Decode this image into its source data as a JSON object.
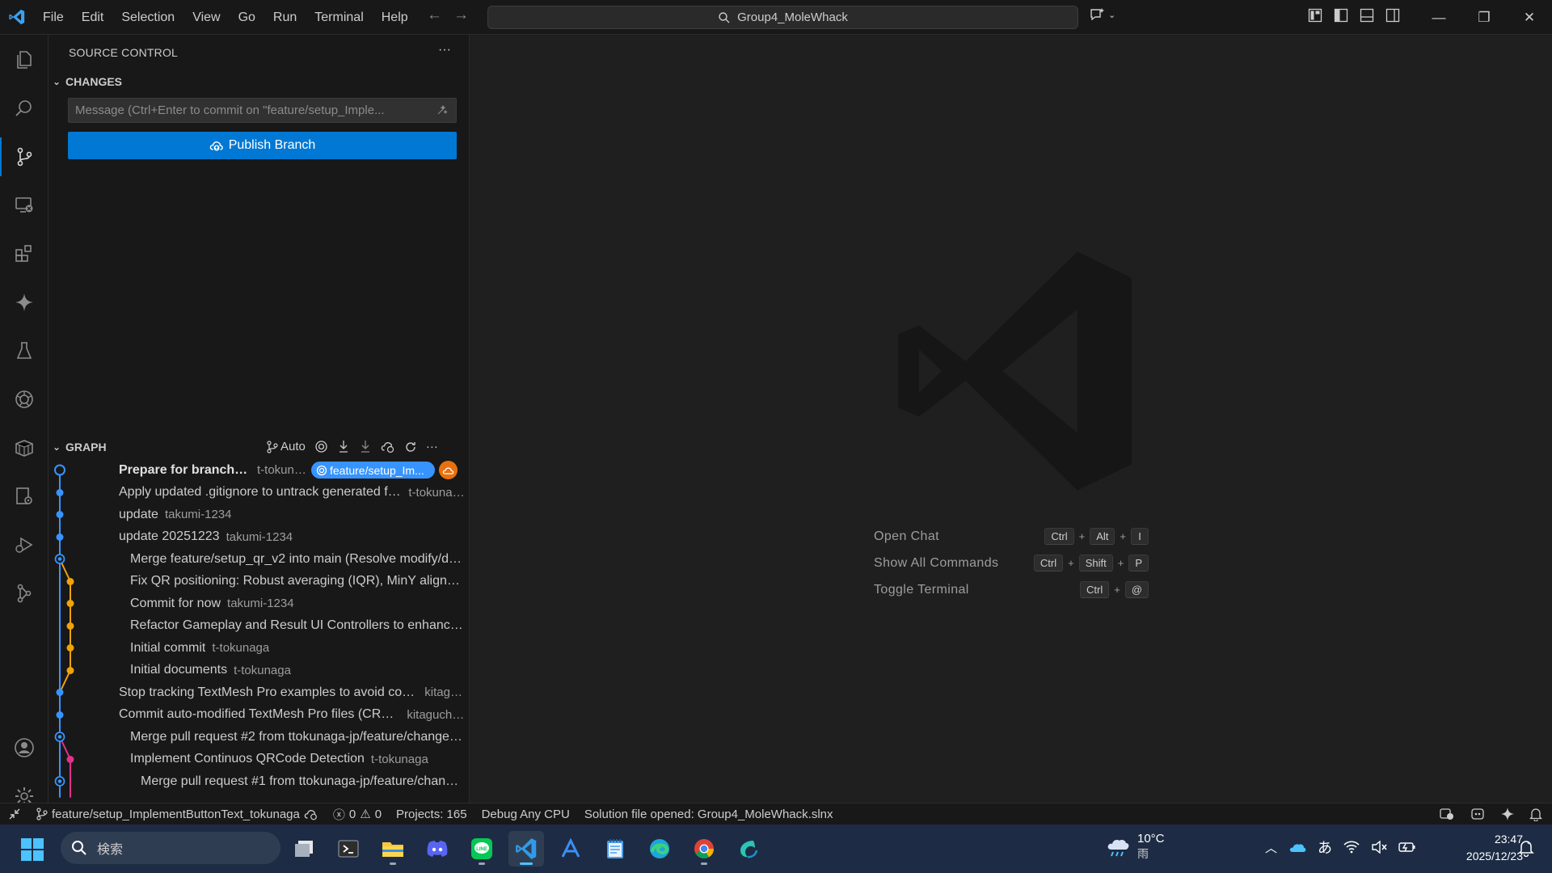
{
  "window": {
    "search_text": "Group4_MoleWhack",
    "menu": [
      "File",
      "Edit",
      "Selection",
      "View",
      "Go",
      "Run",
      "Terminal",
      "Help"
    ]
  },
  "sidebar": {
    "title": "SOURCE CONTROL",
    "changes_label": "CHANGES",
    "commit_placeholder": "Message (Ctrl+Enter to commit on \"feature/setup_Imple...",
    "publish_label": "Publish Branch",
    "graph_label": "GRAPH",
    "graph_auto_label": "Auto",
    "branch_badge": "feature/setup_Im...",
    "commits": [
      {
        "message": "Prepare for branch split",
        "author": "t-tokunaga",
        "color": "#3794ff",
        "lane": 0,
        "hollow": true
      },
      {
        "message": "Apply updated .gitignore to untrack generated files",
        "author": "t-tokunaga",
        "color": "#3794ff",
        "lane": 0
      },
      {
        "message": "update",
        "author": "takumi-1234",
        "color": "#3794ff",
        "lane": 0
      },
      {
        "message": "update 20251223",
        "author": "takumi-1234",
        "color": "#3794ff",
        "lane": 0
      },
      {
        "message": "Merge feature/setup_qr_v2 into main (Resolve modify/delete c...",
        "author": "",
        "color": "#3794ff",
        "lane": 0,
        "merge": true
      },
      {
        "message": "Fix QR positioning: Robust averaging (IQR), MinY alignment, d...",
        "author": "",
        "color": "#f0a30a",
        "lane": 1
      },
      {
        "message": "Commit for now",
        "author": "takumi-1234",
        "color": "#f0a30a",
        "lane": 1
      },
      {
        "message": "Refactor Gameplay and Result UI Controllers to enhance user i...",
        "author": "",
        "color": "#f0a30a",
        "lane": 1
      },
      {
        "message": "Initial commit",
        "author": "t-tokunaga",
        "color": "#f0a30a",
        "lane": 1
      },
      {
        "message": "Initial documents",
        "author": "t-tokunaga",
        "color": "#f0a30a",
        "lane": 1
      },
      {
        "message": "Stop tracking TextMesh Pro examples to avoid conflicts",
        "author": "kitagu...",
        "color": "#3794ff",
        "lane": 0
      },
      {
        "message": "Commit auto-modified TextMesh Pro files (CRLF fix)",
        "author": "kitaguchir...",
        "color": "#3794ff",
        "lane": 0
      },
      {
        "message": "Merge pull request #2 from ttokunaga-jp/feature/change_QR_...",
        "author": "",
        "color": "#3794ff",
        "lane": 0,
        "merge": true
      },
      {
        "message": "Implement Continuos QRCode Detection",
        "author": "t-tokunaga",
        "color": "#e0338a",
        "lane": 1
      },
      {
        "message": "Merge pull request #1 from ttokunaga-jp/feature/change_Q...",
        "author": "",
        "color": "#3794ff",
        "lane": 0,
        "merge": true,
        "indent": 2
      }
    ]
  },
  "editor": {
    "shortcuts": [
      {
        "label": "Open Chat",
        "keys": [
          "Ctrl",
          "Alt",
          "I"
        ]
      },
      {
        "label": "Show All Commands",
        "keys": [
          "Ctrl",
          "Shift",
          "P"
        ]
      },
      {
        "label": "Toggle Terminal",
        "keys": [
          "Ctrl",
          "@"
        ]
      }
    ]
  },
  "statusbar": {
    "branch": "feature/setup_ImplementButtonText_tokunaga",
    "errors": "0",
    "warnings": "0",
    "projects": "Projects: 165",
    "config": "Debug Any CPU",
    "message": "Solution file opened: Group4_MoleWhack.slnx"
  },
  "taskbar": {
    "search_placeholder": "検索",
    "weather_temp": "10°C",
    "weather_desc": "雨",
    "ime": "あ",
    "time": "23:47",
    "date": "2025/12/23"
  },
  "colors": {
    "accent": "#0078d4",
    "lane_blue": "#3794ff",
    "lane_orange": "#f0a30a",
    "lane_pink": "#e0338a"
  }
}
